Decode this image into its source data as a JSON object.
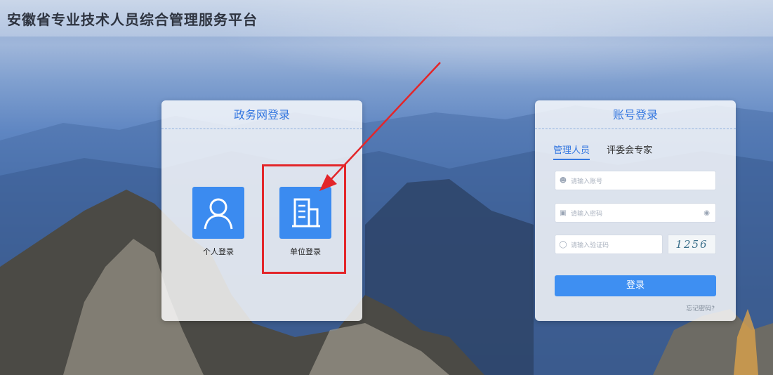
{
  "header": {
    "title": "安徽省专业技术人员综合管理服务平台"
  },
  "gov_login": {
    "title": "政务网登录",
    "options": [
      {
        "label": "个人登录",
        "icon": "person-icon"
      },
      {
        "label": "单位登录",
        "icon": "building-icon"
      }
    ]
  },
  "account_login": {
    "title": "账号登录",
    "tabs": [
      {
        "label": "管理人员",
        "active": true
      },
      {
        "label": "评委会专家",
        "active": false
      }
    ],
    "account_placeholder": "请输入账号",
    "password_placeholder": "请输入密码",
    "captcha_placeholder": "请输入验证码",
    "captcha_text": "1256",
    "submit_label": "登录",
    "forgot_label": "忘记密码?"
  },
  "colors": {
    "accent": "#3b8bf0",
    "highlight": "#e3262a"
  }
}
